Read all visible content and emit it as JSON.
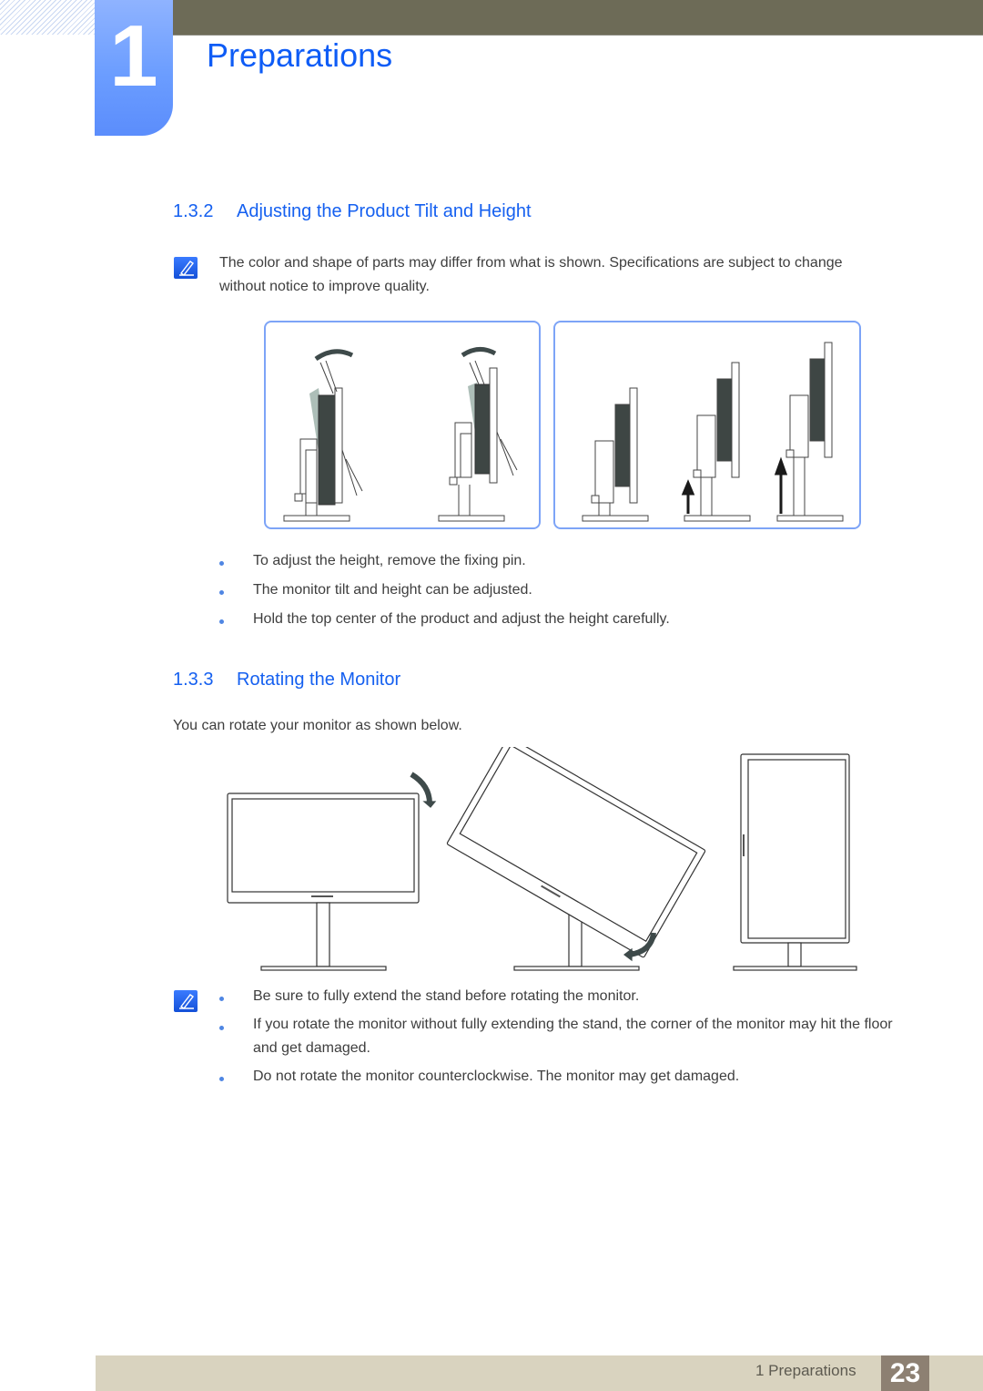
{
  "header": {
    "chapter_number": "1",
    "chapter_title": "Preparations"
  },
  "section_tilt": {
    "number": "1.3.2",
    "title": "Adjusting the Product Tilt and Height",
    "note": "The color and shape of parts may differ from what is shown. Specifications are subject to change without notice to improve quality.",
    "bullets": [
      "To adjust the height, remove the fixing pin.",
      "The monitor tilt and height can be adjusted.",
      "Hold the top center of the product and adjust the height carefully."
    ]
  },
  "section_rotate": {
    "number": "1.3.3",
    "title": "Rotating the Monitor",
    "intro": "You can rotate your monitor as shown below.",
    "notes": [
      "Be sure to fully extend the stand before rotating the monitor.",
      "If you rotate the monitor without fully extending the stand, the corner of the monitor may hit the floor and get damaged.",
      "Do not rotate the monitor counterclockwise. The monitor may get damaged."
    ]
  },
  "footer": {
    "chapter_label": "1 Preparations",
    "page_number": "23"
  },
  "colors": {
    "accent": "#1560f0",
    "topbar": "#6d6b57",
    "footer": "#d9d3bf",
    "page_badge": "#8d8072"
  }
}
